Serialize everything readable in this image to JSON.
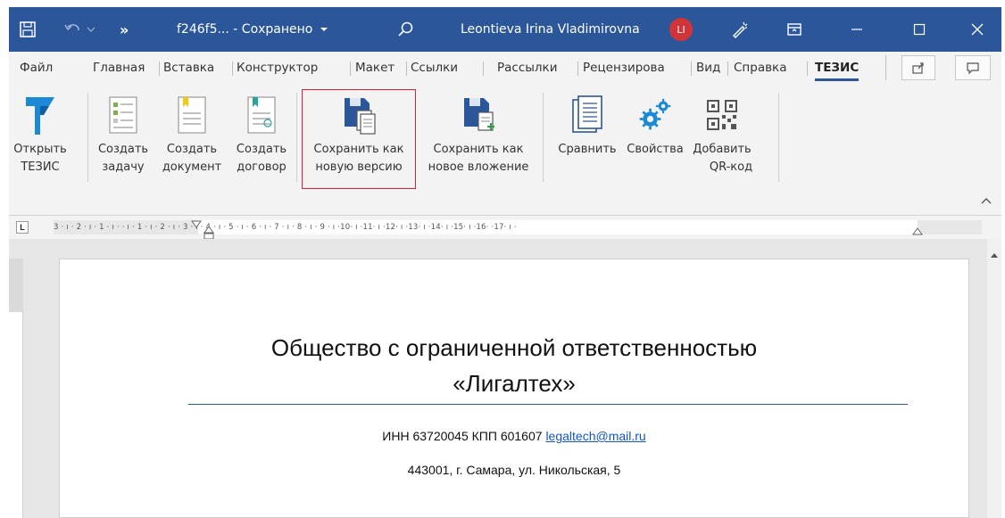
{
  "titlebar": {
    "filename": "f246f5... - Сохранено",
    "user": "Leontieva Irina Vladimirovna",
    "avatar_initials": "LI",
    "overflow": "»"
  },
  "tabs": [
    "Файл",
    "Главная",
    "Вставка",
    "Конструктор",
    "Макет",
    "Ссылки",
    "Рассылки",
    "Рецензирова",
    "Вид",
    "Справка",
    "ТЕЗИС"
  ],
  "ribbon": {
    "open_tezis": [
      "Открыть",
      "ТЕЗИС"
    ],
    "create_task": [
      "Создать",
      "задачу"
    ],
    "create_document": [
      "Создать",
      "документ"
    ],
    "create_contract": [
      "Создать",
      "договор"
    ],
    "save_new_version": [
      "Сохранить как",
      "новую версию"
    ],
    "save_new_attachment": [
      "Сохранить как",
      "новое вложение"
    ],
    "compare": "Сравнить",
    "properties": "Свойства",
    "add_qr": [
      "Добавить",
      "QR-код"
    ]
  },
  "ruler": {
    "marks": "3 · ı · 2 · ı · 1 · ı ·   · ı · 1 · ı · 2 · ı · 3 · ı · 4 · ı · 5 · ı · 6 · ı · 7 · ı · 8 · ı · 9 · ı ·10· ı ·11· ı ·12· ı ·13· ı ·14· ı ·15· ı ·16·   ·17· ı ·"
  },
  "document": {
    "title_line1": "Общество с ограниченной ответственностью",
    "title_line2": "«Лигалтех»",
    "inn_kpp": "ИНН 63720045 КПП 601607",
    "email": "legaltech@mail.ru",
    "address": "443001, г. Самара, ул. Никольская, 5"
  },
  "colors": {
    "titlebar": "#2b579a",
    "ribbon": "#f3f3f3",
    "avatar": "#d13438",
    "highlight": "#d9232e"
  }
}
